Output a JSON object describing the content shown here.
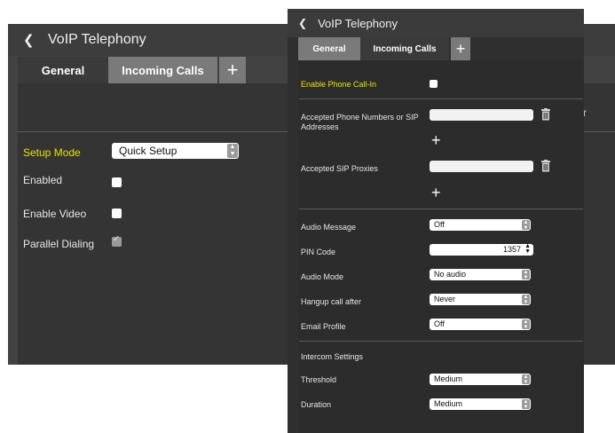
{
  "back_panel": {
    "title": "VoIP Telephony",
    "back_icon": "chevron-left-icon",
    "tabs": [
      {
        "label": "General",
        "active": true
      },
      {
        "label": "Incoming Calls",
        "active": false
      }
    ],
    "add_tab_label": "+",
    "fields": {
      "setup_mode_label": "Setup Mode",
      "setup_mode_value": "Quick Setup",
      "enabled_label": "Enabled",
      "enable_video_label": "Enable Video",
      "parallel_dialing_label": "Parallel Dialing"
    },
    "cut_text": "r"
  },
  "front_panel": {
    "title": "VoIP Telephony",
    "back_icon": "chevron-left-icon",
    "tabs": [
      {
        "label": "General",
        "active": false
      },
      {
        "label": "Incoming Calls",
        "active": true
      }
    ],
    "add_tab_label": "+",
    "enable_call_in_label": "Enable Phone Call-In",
    "accepted_numbers_label": "Accepted Phone Numbers or SIP Addresses",
    "accepted_proxies_label": "Accepted SIP Proxies",
    "add_label": "+",
    "audio_message_label": "Audio Message",
    "audio_message_value": "Off",
    "pin_code_label": "PIN Code",
    "pin_code_value": "1357",
    "audio_mode_label": "Audio Mode",
    "audio_mode_value": "No audio",
    "hangup_label": "Hangup call after",
    "hangup_value": "Never",
    "email_profile_label": "Email Profile",
    "email_profile_value": "Off",
    "intercom_settings_label": "Intercom Settings",
    "threshold_label": "Threshold",
    "threshold_value": "Medium",
    "duration_label": "Duration",
    "duration_value": "Medium"
  },
  "colors": {
    "accent_yellow": "#e8e200",
    "panel_dark": "#2f2f2f",
    "tab_inactive": "#7a7a7a"
  }
}
